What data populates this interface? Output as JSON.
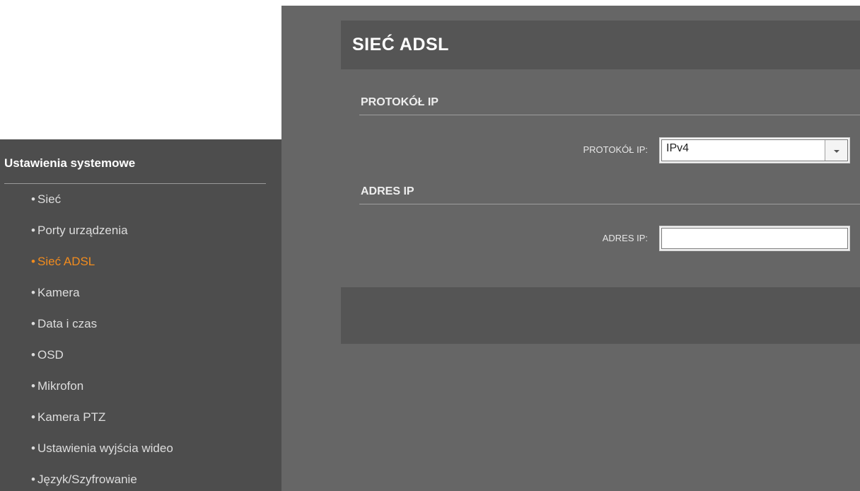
{
  "sidebar": {
    "title": "Ustawienia systemowe",
    "bullet": "•",
    "items": [
      {
        "label": "Sieć"
      },
      {
        "label": "Porty urządzenia"
      },
      {
        "label": "Sieć ADSL"
      },
      {
        "label": "Kamera"
      },
      {
        "label": "Data i czas"
      },
      {
        "label": "OSD"
      },
      {
        "label": "Mikrofon"
      },
      {
        "label": "Kamera PTZ"
      },
      {
        "label": "Ustawienia wyjścia wideo"
      },
      {
        "label": "Język/Szyfrowanie"
      }
    ],
    "active_index": 2,
    "active_color": "#f28c1e"
  },
  "main": {
    "title": "SIEĆ ADSL",
    "protocol_section": {
      "title": "PROTOKÓŁ IP",
      "field_label": "PROTOKÓŁ IP:",
      "selected_value": "IPv4"
    },
    "address_section": {
      "title": "ADRES IP",
      "field_label": "ADRES IP:",
      "value": ""
    }
  },
  "colors": {
    "sidebar_bg": "#4d4d4d",
    "main_bg": "#666666",
    "header_bg": "#555555",
    "accent": "#f28c1e"
  }
}
